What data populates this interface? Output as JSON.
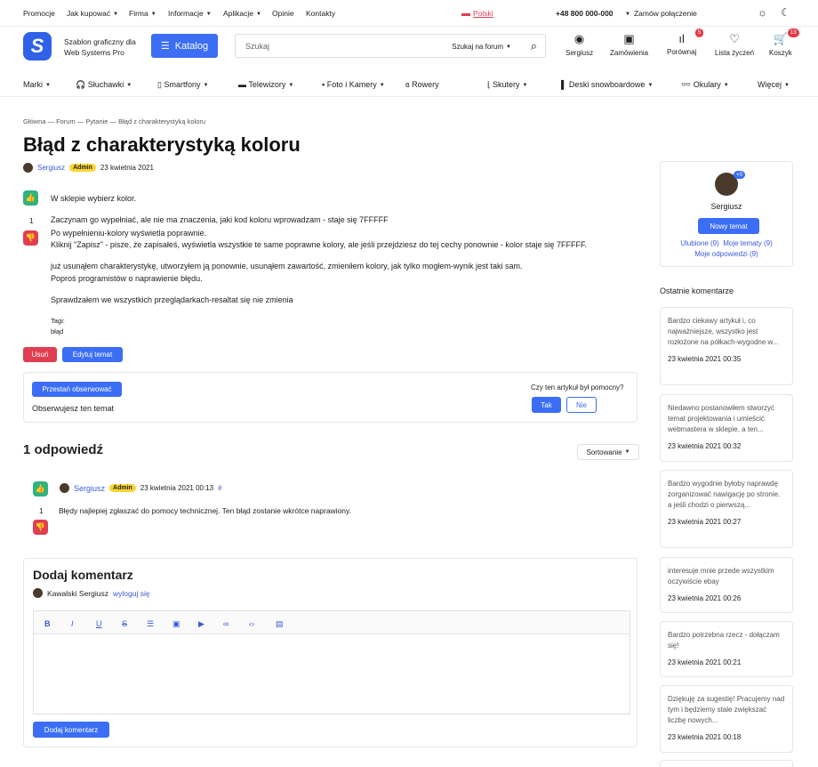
{
  "topbar": {
    "items": [
      "Promocje",
      "Jak kupować",
      "Firma",
      "Informacje",
      "Aplikacje",
      "Opinie",
      "Kontakty"
    ],
    "language": "Polski",
    "phone": "+48 800 000-000",
    "callback": "Zamów połączenie"
  },
  "header": {
    "brand": "Szablon graficzny dla Web Systems Pro",
    "katalog": "Katalog",
    "search_placeholder": "Szukaj",
    "search_scope": "Szukaj na forum",
    "icons": {
      "user": "Sergiusz",
      "orders": "Zamówienia",
      "compare": "Porównaj",
      "wishlist": "Lista życzeń",
      "cart": "Koszyk"
    },
    "compare_badge": "5",
    "cart_badge": "13"
  },
  "nav": [
    "Marki",
    "Słuchawki",
    "Smartfony",
    "Telewizory",
    "Foto i Kamery",
    "Rowery",
    "Skutery",
    "Deski snowboardowe",
    "Okulary",
    "Więcej"
  ],
  "breadcrumb": "Główna — Forum — Pytanie — Błąd z charakterystyką koloru",
  "title": "Błąd z charakterystyką koloru",
  "author": {
    "name": "Sergiusz",
    "role": "Admin",
    "date": "23 kwietnia 2021"
  },
  "post": {
    "vote_count": "1",
    "lines": [
      "W sklepie wybierz kolor.",
      "Zaczynam go wypełniać, ale nie ma znaczenia, jaki kod koloru wprowadzam - staje się 7FFFFF",
      "Po wypełnieniu-kolory wyświetla poprawnie.",
      "Kliknij \"Zapisz\" - pisze, że zapisałeś, wyświetla wszystkie te same poprawne kolory, ale jeśli przejdziesz do tej cechy ponownie - kolor staje się 7FFFFF.",
      "już usunąłem charakterystykę, utworzyłem ją ponownie, usunąłem zawartość, zmieniłem kolory, jak tylko mogłem-wynik jest taki sam.",
      "Poproś programistów o naprawienie błędu.",
      "Sprawdzałem we wszystkich przeglądarkach-resaltat się nie zmienia"
    ],
    "tags_label": "Tagi:",
    "tag": "błąd"
  },
  "actions": {
    "delete": "Usuń",
    "edit": "Edytuj temat"
  },
  "follow": {
    "button": "Przestań obserwować",
    "status": "Obserwujesz ten temat",
    "question": "Czy ten artykuł był pomocny?",
    "yes": "Tak",
    "no": "Nie"
  },
  "answers": {
    "heading": "1 odpowiedź",
    "sort": "Sortowanie",
    "reply": {
      "name": "Sergiusz",
      "role": "Admin",
      "date": "23 kwietnia 2021 00:13",
      "hash": "#",
      "count": "1",
      "text": "Błędy najlepiej zgłaszać do pomocy technicznej. Ten błąd zostanie wkrótce naprawiony."
    }
  },
  "comment": {
    "heading": "Dodaj komentarz",
    "user": "Kawalski Sergiusz",
    "logout": "wyloguj się",
    "submit": "Dodaj komentarz"
  },
  "sidebar": {
    "user": "Sergiusz",
    "plus": "+0",
    "new_topic": "Nowy temat",
    "links": "Ulubione (9)  Moje tematy (9)",
    "links2": "Moje odpowiedzi (9)",
    "recent_heading": "Ostatnie komentarze",
    "comments": [
      {
        "text": "Bardzo ciekawy artykuł i, co najważniejsze, wszystko jest rozłożone na półkach-wygodne w...",
        "date": "23 kwietnia 2021 00:35"
      },
      {
        "text": "Niedawno postanowiłem stworzyć temat projektowania i umieścić webmastera w sklepie, a ten...",
        "date": "23 kwietnia 2021 00:32"
      },
      {
        "text": "Bardzo wygodnie byłoby naprawdę zorganizować nawigację po stronie. a jeśli chodzi o pierwszą...",
        "date": "23 kwietnia 2021 00:27"
      },
      {
        "text": "interesuje mnie przede wszystkim oczywiście ebay",
        "date": "23 kwietnia 2021 00:26"
      },
      {
        "text": "Bardzo potrzebna rzecz - dołączam się!",
        "date": "23 kwietnia 2021 00:21"
      },
      {
        "text": "Dziękuję za sugestię! Pracujemy nad tym i będziemy stale zwiększać liczbę nowych...",
        "date": "23 kwietnia 2021 00:18"
      }
    ]
  }
}
